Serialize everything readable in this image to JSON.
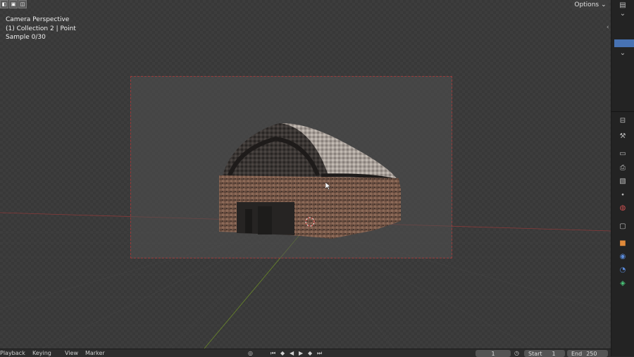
{
  "viewport": {
    "overlay_lines": [
      "Camera Perspective",
      "(1) Collection 2 | Point",
      "Sample 0/30"
    ],
    "options_label": "Options",
    "options_chevron_icon": "chevron-down-icon",
    "collapse_icon": "chevron-left-icon"
  },
  "top_tools": [
    "mode-icon",
    "select-icon",
    "overlay-icon"
  ],
  "right_panel": {
    "icons": [
      "tool-icon",
      "render-icon",
      "output-icon",
      "view-layer-icon",
      "scene-icon",
      "world-icon",
      "collection-icon",
      "object-icon",
      "modifier-icon",
      "particles-icon",
      "physics-icon"
    ]
  },
  "timeline": {
    "menus": [
      "Playback",
      "Keying",
      "View",
      "Marker"
    ],
    "current_frame": "1",
    "start_label": "Start",
    "start_value": "1",
    "end_label": "End",
    "end_value": "250"
  },
  "colors": {
    "accent_blue": "#4772b3",
    "frame_border": "#9a3b3b",
    "x_axis": "#8a3a3a",
    "y_axis": "#6b8a2a"
  }
}
